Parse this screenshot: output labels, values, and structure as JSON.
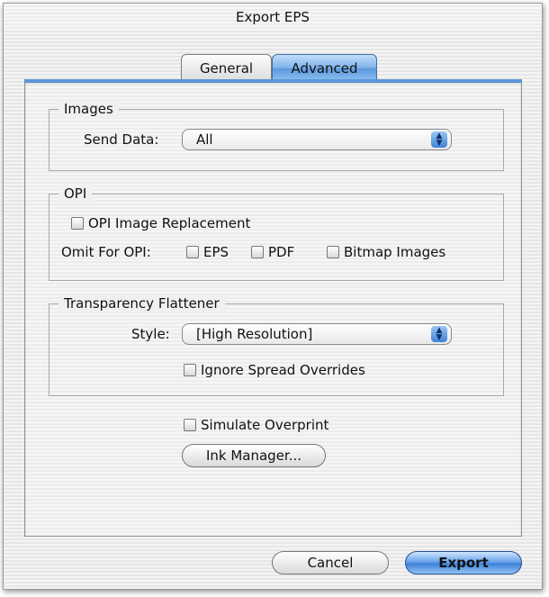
{
  "window": {
    "title": "Export EPS"
  },
  "tabs": {
    "general": "General",
    "advanced": "Advanced"
  },
  "images": {
    "legend": "Images",
    "send_data_label": "Send Data:",
    "send_data_value": "All"
  },
  "opi": {
    "legend": "OPI",
    "image_replacement_label": "OPI Image Replacement",
    "omit_label": "Omit For OPI:",
    "eps_label": "EPS",
    "pdf_label": "PDF",
    "bitmap_label": "Bitmap Images"
  },
  "flattener": {
    "legend": "Transparency Flattener",
    "style_label": "Style:",
    "style_value": "[High Resolution]",
    "ignore_overrides_label": "Ignore Spread Overrides"
  },
  "simulate_overprint_label": "Simulate Overprint",
  "ink_manager_label": "Ink Manager...",
  "buttons": {
    "cancel": "Cancel",
    "export": "Export"
  },
  "colors": {
    "accent": "#5a95d8"
  }
}
